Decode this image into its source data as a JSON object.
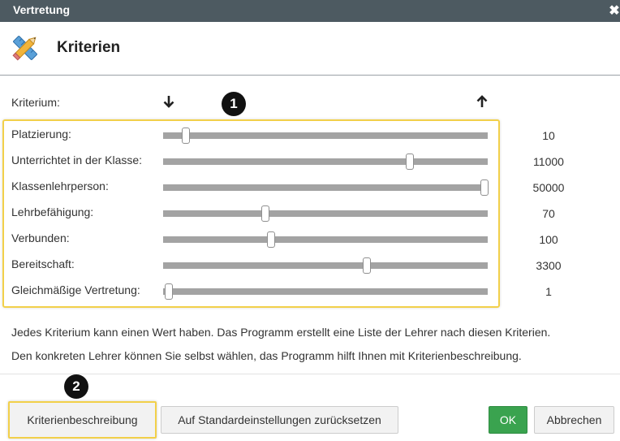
{
  "window": {
    "title": "Vertretung",
    "close_symbol": "✖"
  },
  "header": {
    "title": "Kriterien",
    "icon": "ruler-pencil-icon"
  },
  "criteria": {
    "header_label": "Kriterium:",
    "arrow_low": "arrow-down-icon",
    "arrow_high": "arrow-up-icon",
    "items": [
      {
        "label": "Platzierung:",
        "value": "10",
        "slider_fraction": 0.07
      },
      {
        "label": "Unterrichtet in der Klasse:",
        "value": "11000",
        "slider_fraction": 0.76
      },
      {
        "label": "Klassenlehrperson:",
        "value": "50000",
        "slider_fraction": 0.99
      },
      {
        "label": "Lehrbefähigung:",
        "value": "70",
        "slider_fraction": 0.315
      },
      {
        "label": "Verbunden:",
        "value": "100",
        "slider_fraction": 0.332
      },
      {
        "label": "Bereitschaft:",
        "value": "3300",
        "slider_fraction": 0.627
      },
      {
        "label": "Gleichmäßige Vertretung:",
        "value": "1",
        "slider_fraction": 0.017
      }
    ]
  },
  "description": {
    "line1": "Jedes Kriterium kann einen Wert haben. Das Programm erstellt eine Liste der Lehrer nach diesen Kriterien.",
    "line2": "Den konkreten Lehrer können Sie selbst wählen, das Programm hilft Ihnen mit Kriterienbeschreibung."
  },
  "annotations": {
    "badge1": "1",
    "badge2": "2"
  },
  "buttons": {
    "criteria_description": "Kriterienbeschreibung",
    "reset_defaults": "Auf Standardeinstellungen zurücksetzen",
    "ok": "OK",
    "cancel": "Abbrechen"
  },
  "colors": {
    "titlebar": "#4d5a61",
    "highlight": "#f2d04a",
    "ok_button": "#3aa34f",
    "slider_track": "#a3a3a3"
  }
}
